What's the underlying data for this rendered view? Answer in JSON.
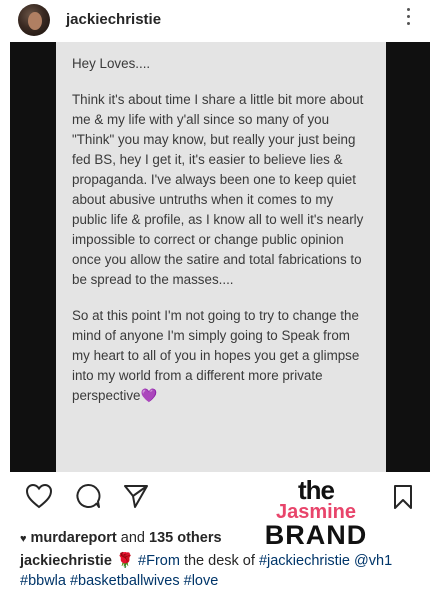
{
  "header": {
    "username": "jackiechristie",
    "avatar_icon": "profile-photo",
    "more_icon": "more-vertical-icon"
  },
  "post": {
    "paragraphs": [
      "Hey Loves....",
      "Think it's about time I share a little bit more about me & my life with y'all since so many of you \"Think\" you may know, but really your just being fed BS, hey I get it, it's easier to believe lies & propaganda. I've always been one to keep quiet about abusive untruths when it comes to my public life & profile, as I know all to well it's nearly impossible to correct or change public opinion once you allow the satire and total fabrications to be spread to the masses....",
      "So at this point I'm not going to try to change the mind of anyone I'm simply going to Speak from my heart to all of you in hopes you get a glimpse into my world from a different more private perspective"
    ],
    "purple_heart": "💜"
  },
  "actions": {
    "like_icon": "heart-outline-icon",
    "comment_icon": "comment-icon",
    "share_icon": "send-icon",
    "save_icon": "bookmark-icon"
  },
  "watermark": {
    "the": "the",
    "jasmine": "Jasmine",
    "brand": "BRAND",
    "accent_color": "#e8456b"
  },
  "likes": {
    "heart": "♥",
    "user": "murdareport",
    "and_text": "and",
    "others": "135 others"
  },
  "caption": {
    "username": "jackiechristie",
    "rose": "🌹",
    "hashtag_from": "#From",
    "text_middle": "the desk of",
    "hashtag_jackie": "#jackiechristie",
    "mention": "@vh1",
    "hashtag_bbwla": "#bbwla",
    "hashtag_basketball": "#basketballwives",
    "hashtag_love": "#love"
  }
}
